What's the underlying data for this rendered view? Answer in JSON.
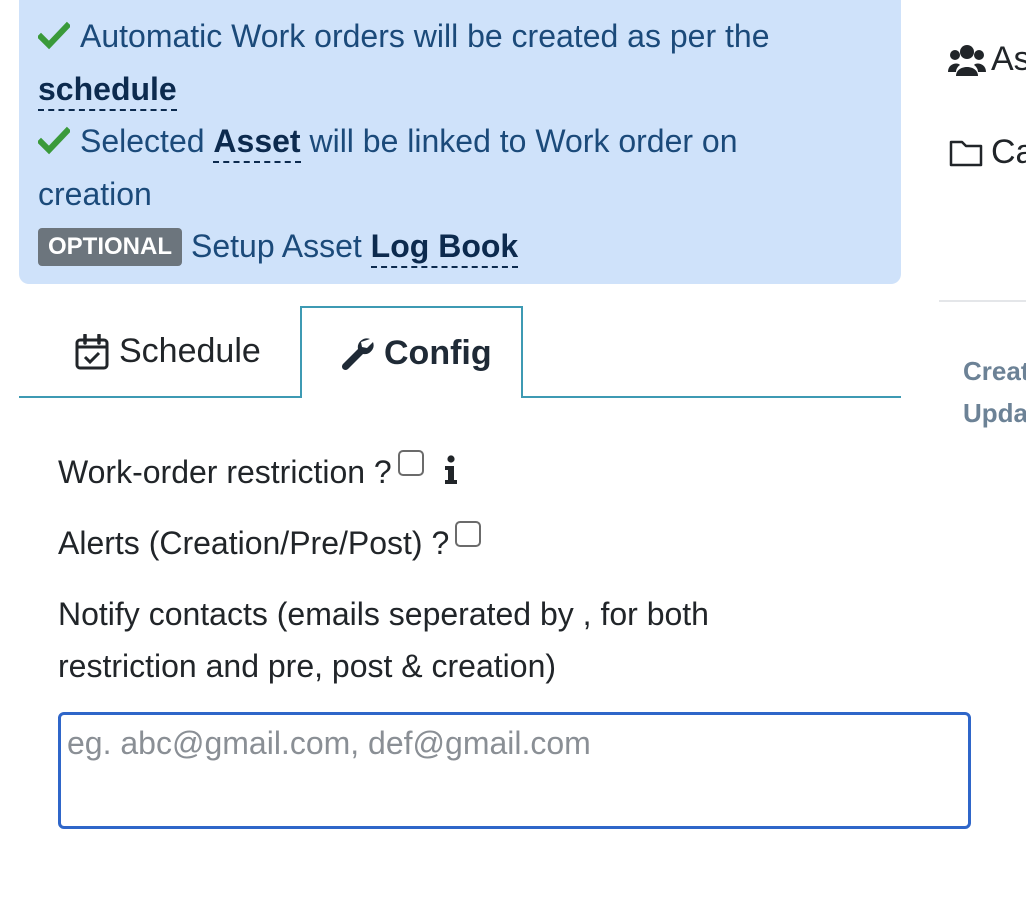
{
  "info": {
    "line1_text": "Automatic Work orders will be created as per the",
    "line1_link": "schedule",
    "line2_pre": "Selected",
    "line2_link": "Asset",
    "line2_post": "will be linked to Work order on",
    "line2_cont": "creation",
    "line3_badge": "OPTIONAL",
    "line3_text": "Setup Asset",
    "line3_link": "Log Book"
  },
  "tabs": [
    {
      "label": "Schedule",
      "icon": "calendar-check-icon",
      "active": false
    },
    {
      "label": "Config",
      "icon": "wrench-icon",
      "active": true
    }
  ],
  "form": {
    "restriction_label": "Work-order restriction ?",
    "alerts_label": "Alerts (Creation/Pre/Post) ?",
    "notify_label": "Notify contacts (emails seperated by , for both restriction and pre, post & creation)",
    "notify_placeholder": "eg. abc@gmail.com, def@gmail.com",
    "notify_value": ""
  },
  "sidebar": {
    "item1": "As",
    "item1_icon": "users-icon",
    "item2": "Ca",
    "item2_icon": "folder-icon",
    "created": "Creat",
    "updated": "Upda"
  },
  "colors": {
    "info_bg": "#cfe2fa",
    "info_text": "#1b4a7a",
    "check_green": "#3a9a3a",
    "tab_border": "#3d9ab3",
    "badge_bg": "#6c757d",
    "input_border": "#2f66c9"
  }
}
